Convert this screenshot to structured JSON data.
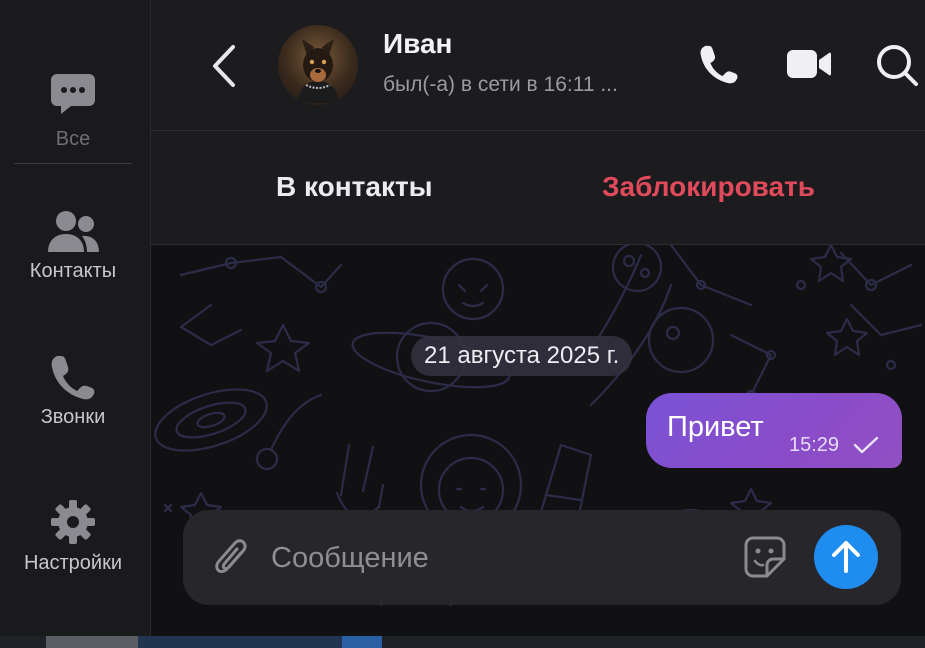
{
  "sidebar": {
    "items": [
      {
        "label": "Все",
        "icon": "chat-bubble-icon"
      },
      {
        "label": "Контакты",
        "icon": "people-icon"
      },
      {
        "label": "Звонки",
        "icon": "phone-icon"
      },
      {
        "label": "Настройки",
        "icon": "gear-icon"
      }
    ]
  },
  "header": {
    "name": "Иван",
    "status": "был(-а) в сети в 16:11 ..."
  },
  "actions": {
    "add_contact": "В контакты",
    "block": "Заблокировать"
  },
  "chat": {
    "date": "21 августа 2025 г.",
    "messages": [
      {
        "text": "Привет",
        "time": "15:29",
        "outgoing": true,
        "status": "sent"
      }
    ]
  },
  "composer": {
    "placeholder": "Сообщение"
  },
  "colors": {
    "accent_send": "#1f8cf0",
    "block_red": "#e14a5a",
    "bubble_gradient_start": "#7a52d6",
    "bubble_gradient_end": "#9150c2"
  }
}
